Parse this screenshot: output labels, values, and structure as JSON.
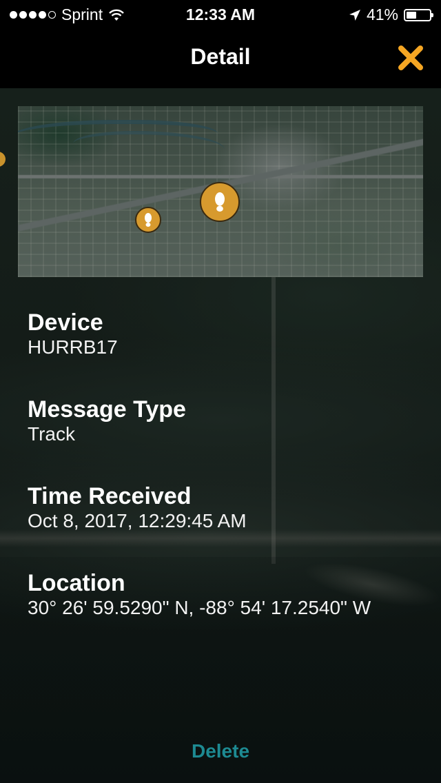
{
  "status_bar": {
    "carrier": "Sprint",
    "time": "12:33 AM",
    "battery_percent": "41%",
    "battery_level": 0.41,
    "signal_bars_filled": 4,
    "signal_bars_total": 5
  },
  "nav": {
    "title": "Detail",
    "close_icon": "close-x-icon"
  },
  "colors": {
    "accent": "#f5a623",
    "delete_text": "#1d8a92",
    "pin": "#d79a2e"
  },
  "details": {
    "device": {
      "label": "Device",
      "value": "HURRB17"
    },
    "message_type": {
      "label": "Message Type",
      "value": "Track"
    },
    "time_received": {
      "label": "Time Received",
      "value": "Oct 8, 2017, 12:29:45 AM"
    },
    "location": {
      "label": "Location",
      "value": "30° 26' 59.5290\" N, -88° 54' 17.2540\" W"
    }
  },
  "actions": {
    "delete_label": "Delete"
  }
}
